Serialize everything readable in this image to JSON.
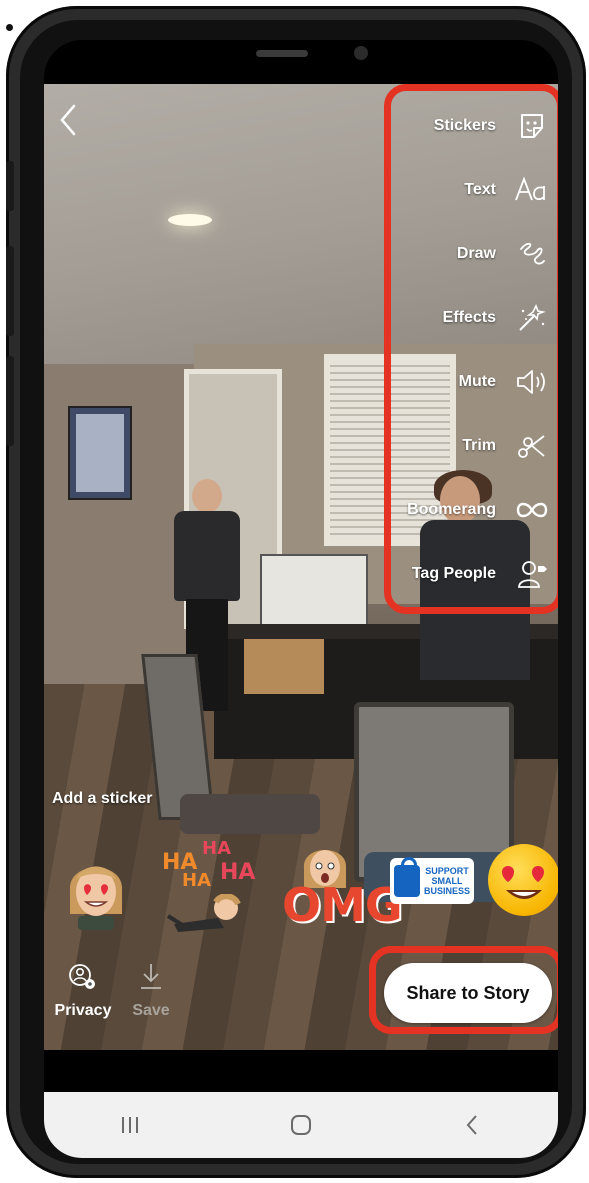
{
  "colors": {
    "highlight": "#e53323",
    "text_on_video": "#ffffff",
    "save_disabled": "#a8a39c",
    "nav_bar": "#f1f1f1",
    "share_bg": "#ffffff"
  },
  "header": {
    "back_icon": "chevron-left-icon"
  },
  "tools": [
    {
      "label": "Stickers",
      "icon": "sticker-icon"
    },
    {
      "label": "Text",
      "icon": "text-aa-icon"
    },
    {
      "label": "Draw",
      "icon": "squiggle-icon"
    },
    {
      "label": "Effects",
      "icon": "magic-wand-icon"
    },
    {
      "label": "Mute",
      "icon": "speaker-icon"
    },
    {
      "label": "Trim",
      "icon": "scissors-icon"
    },
    {
      "label": "Boomerang",
      "icon": "infinity-icon"
    },
    {
      "label": "Tag People",
      "icon": "tag-person-icon"
    }
  ],
  "stickers": {
    "heading": "Add a sticker",
    "haha_words": [
      "HA",
      "HA",
      "HA",
      "HA"
    ],
    "omg": "OMG",
    "support_badge": {
      "line1": "SUPPORT",
      "line2": "SMALL",
      "line3": "BUSINESS"
    }
  },
  "actions": {
    "privacy_label": "Privacy",
    "privacy_icon": "privacy-gear-icon",
    "save_label": "Save",
    "save_icon": "download-icon"
  },
  "share": {
    "label": "Share to Story"
  },
  "nav": {
    "recents_icon": "recents-icon",
    "home_icon": "home-icon",
    "back_icon": "nav-back-icon"
  }
}
